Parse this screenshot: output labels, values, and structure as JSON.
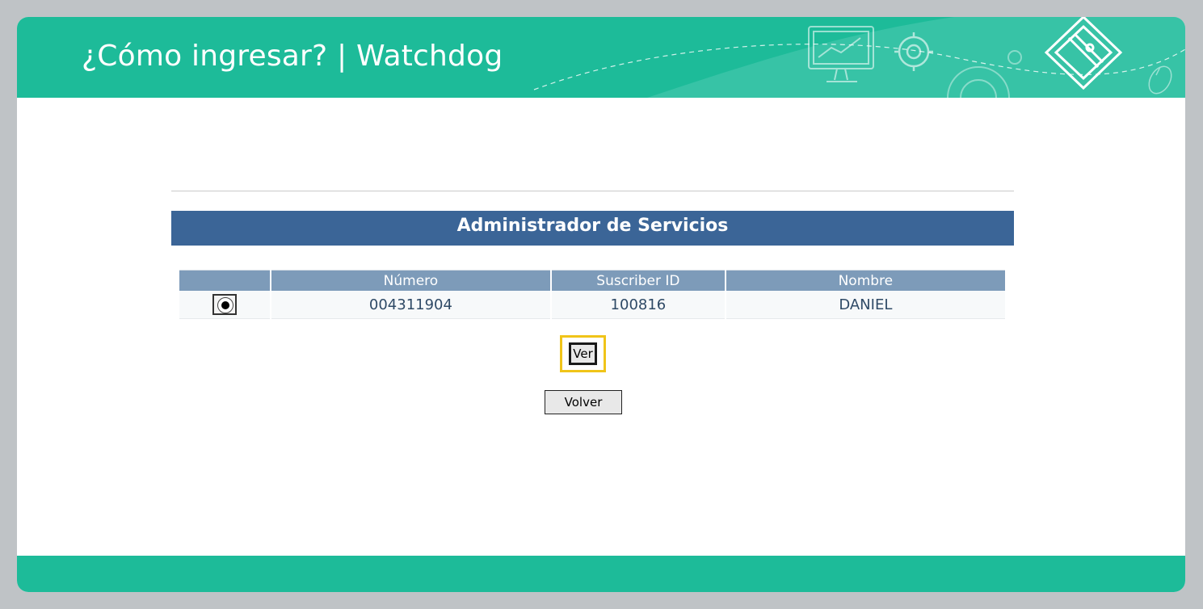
{
  "header": {
    "title": "¿Cómo ingresar? | Watchdog",
    "icons": [
      "monitor-chart-icon",
      "gear-icon",
      "gears-icon",
      "pencil-diamond-icon",
      "mouse-icon"
    ],
    "color": "#1dbb99"
  },
  "panel": {
    "title": "Administrador de Servicios",
    "color": "#3b6597"
  },
  "table": {
    "columns": [
      "",
      "Número",
      "Suscriber ID",
      "Nombre"
    ],
    "rows": [
      {
        "selected": true,
        "numero": "004311904",
        "suscriber_id": "100816",
        "nombre": "DANIEL"
      }
    ],
    "header_color": "#7d9bb9"
  },
  "buttons": {
    "ver_label": "Ver",
    "volver_label": "Volver",
    "highlight_color": "#f0c419"
  }
}
